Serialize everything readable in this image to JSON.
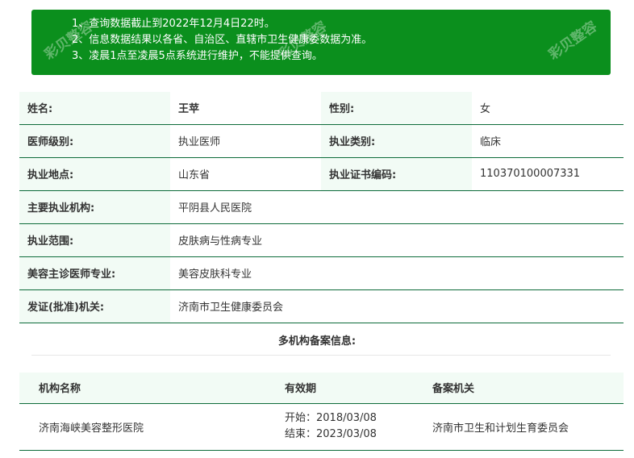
{
  "notice": {
    "lines": [
      "1、查询数据截止到2022年12月4日22时。",
      "2、信息数据结果以各省、自治区、直辖市卫生健康委数据为准。",
      "3、凌晨1点至凌晨5点系统进行维护，不能提供查询。"
    ]
  },
  "doctor": {
    "name_label": "姓名:",
    "name": "王苹",
    "gender_label": "性别:",
    "gender": "女",
    "level_label": "医师级别:",
    "level": "执业医师",
    "category_label": "执业类别:",
    "category": "临床",
    "location_label": "执业地点:",
    "location": "山东省",
    "cert_label": "执业证书编码:",
    "cert": "110370100007331",
    "org_label": "主要执业机构:",
    "org": "平阴县人民医院",
    "scope_label": "执业范围:",
    "scope": "皮肤病与性病专业",
    "cosmetic_label": "美容主诊医师专业:",
    "cosmetic": "美容皮肤科专业",
    "issuer_label": "发证(批准)机关:",
    "issuer": "济南市卫生健康委员会"
  },
  "registrations": {
    "title": "多机构备案信息:",
    "headers": [
      "机构名称",
      "有效期",
      "备案机关"
    ],
    "rows": [
      {
        "org": "济南海峡美容整形医院",
        "start": "开始：2018/03/08",
        "end": "结束：2023/03/08",
        "authority": "济南市卫生和计划生育委员会"
      }
    ]
  },
  "watermark": "彩贝整容"
}
